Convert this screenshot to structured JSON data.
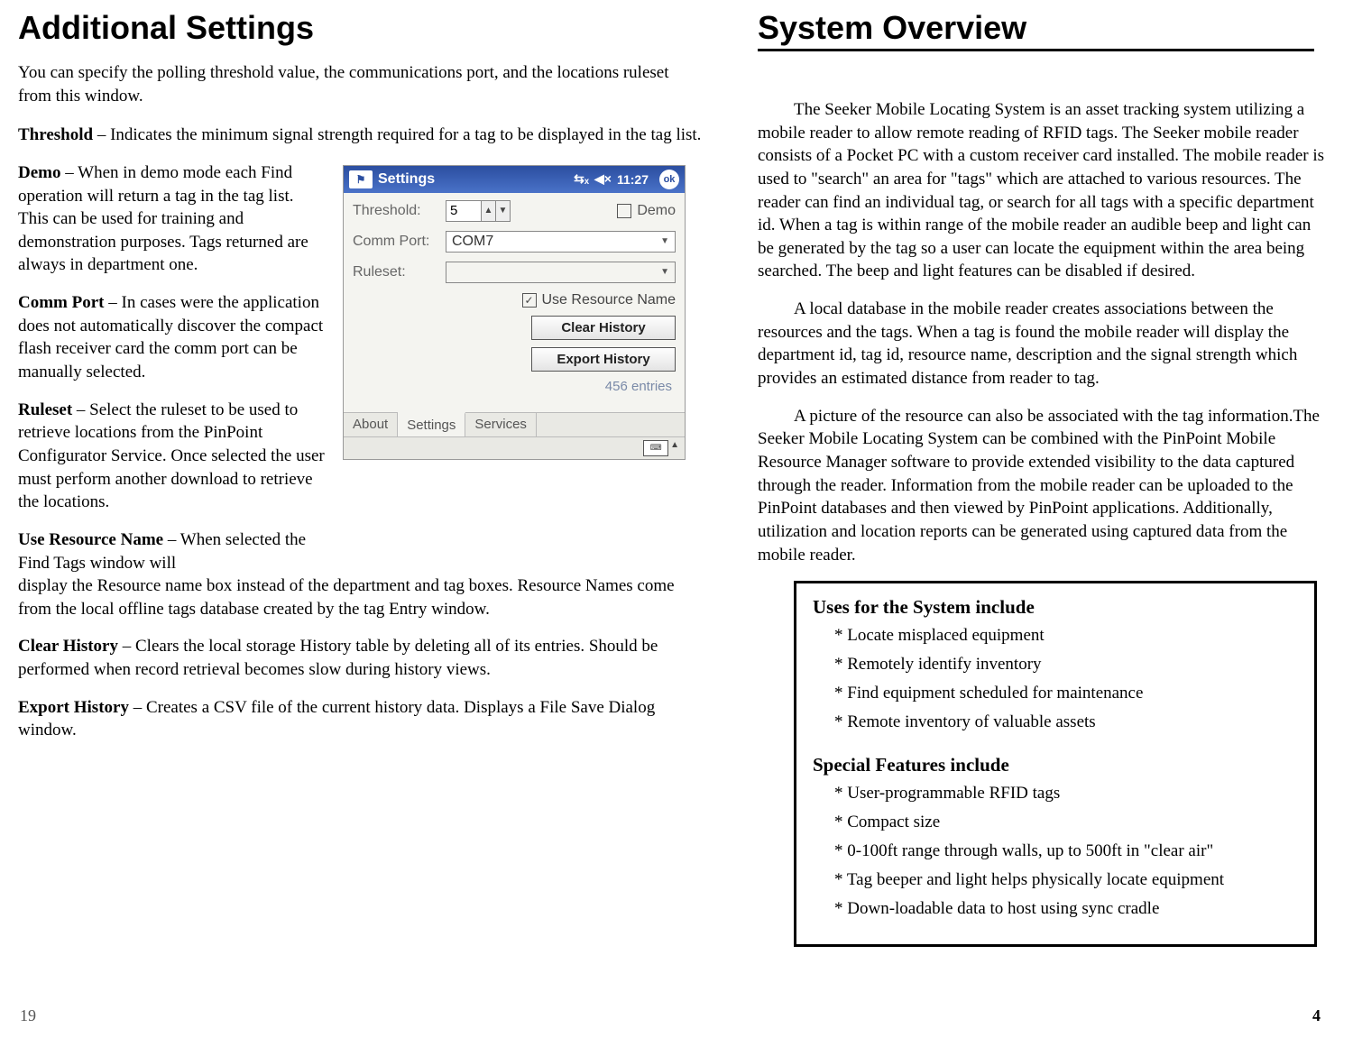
{
  "left": {
    "heading": "Additional Settings",
    "intro": "You can specify the polling threshold value, the communications port, and the locations ruleset from this window.",
    "defs_a": [
      {
        "term": "Threshold",
        "text": " – Indicates the minimum signal strength required for a tag to be displayed in the tag list."
      }
    ],
    "defs_side": [
      {
        "term": "Demo",
        "text": " – When in demo mode each Find operation will return a tag in the tag list.  This can be used for training and demonstration purposes.  Tags returned are always in department one."
      },
      {
        "term": "Comm Port",
        "text": " – In cases were the application does not automatically discover the compact flash receiver card the comm port can be manually selected."
      },
      {
        "term": "Ruleset",
        "text": " – Select the ruleset to be used to retrieve locations from the PinPoint Configurator Service.  Once selected the user must perform another download to retrieve the locations."
      }
    ],
    "use_res_term": "Use Resource Name",
    "use_res_lead": " – When selected the Find Tags window will",
    "use_res_rest": "display the Resource name box instead of the department and tag boxes.  Resource Names come from the local offline tags database created by the tag Entry window.",
    "defs_b": [
      {
        "term": "Clear History",
        "text": " – Clears the local storage History table by deleting all of its entries.  Should be performed when record retrieval becomes slow during history views."
      },
      {
        "term": "Export History",
        "text": " – Creates a CSV file of the current history data.  Displays a File Save Dialog window."
      }
    ],
    "page": "19"
  },
  "ppc": {
    "title": "Settings",
    "time": "11:27",
    "ok": "ok",
    "labels": {
      "threshold": "Threshold:",
      "commport": "Comm Port:",
      "ruleset": "Ruleset:"
    },
    "threshold_value": "5",
    "commport_value": "COM7",
    "ruleset_value": "",
    "demo_label": "Demo",
    "demo_checked": false,
    "use_resource_label": "Use Resource Name",
    "use_resource_checked": true,
    "btn_clear": "Clear History",
    "btn_export": "Export History",
    "entries": "456 entries",
    "tabs": [
      "About",
      "Settings",
      "Services"
    ],
    "active_tab": 1
  },
  "right": {
    "heading": "System Overview",
    "paras": [
      "The Seeker Mobile Locating System is an asset tracking system utilizing a mobile reader to allow remote reading of RFID tags. The Seeker mobile reader consists of a Pocket PC with a custom receiver card installed.  The mobile reader is used to \"search\" an area for \"tags\" which are attached to various resources. The reader can find an individual tag, or search for all tags with a specific department id. When a tag is within range of the mobile reader an audible beep and light can be generated by the tag so a user can locate the equipment within the area being searched. The beep and light features can be disabled if desired.",
      "A local database in the mobile reader creates associations between the resources and the tags.  When a tag is found the mobile reader will display the department id, tag id, resource name, description and the signal strength which provides an estimated distance from reader to tag.",
      "A picture of the resource can also be associated with the tag information.The Seeker Mobile Locating System can be combined with the PinPoint Mobile Resource Manager software to provide extended visibility to the data captured through the reader. Information from the mobile reader can be uploaded to the PinPoint databases and then viewed by PinPoint applications. Additionally, utilization and location reports can be generated using captured data from the mobile reader."
    ],
    "box": {
      "uses_h": "Uses for the System include",
      "uses": [
        "* Locate misplaced equipment",
        "* Remotely identify inventory",
        "* Find equipment scheduled for maintenance",
        "* Remote inventory of valuable assets"
      ],
      "feat_h": "Special Features include",
      "feats": [
        "* User-programmable RFID tags",
        "* Compact size",
        "* 0-100ft range through walls, up to 500ft in \"clear air\"",
        "* Tag beeper and light helps physically locate equipment",
        "* Down-loadable data to host using sync cradle"
      ]
    },
    "page": "4"
  }
}
